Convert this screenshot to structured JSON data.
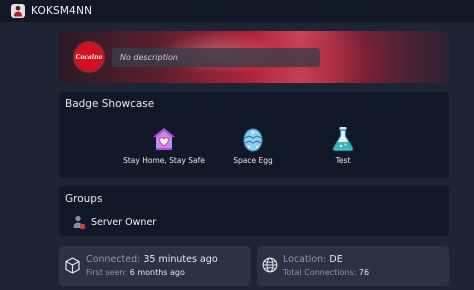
{
  "header": {
    "username": "KOKSM4NN",
    "avatar_icon": "person-avatar-icon"
  },
  "banner": {
    "logo_text": "Cocaine",
    "description": "No description",
    "logo_color": "#d2101f"
  },
  "badge_showcase": {
    "title": "Badge Showcase",
    "badges": [
      {
        "label": "Stay Home, Stay Safe",
        "icon": "heart-house-icon"
      },
      {
        "label": "Space Egg",
        "icon": "egg-icon"
      },
      {
        "label": "Test",
        "icon": "flask-icon"
      }
    ]
  },
  "groups": {
    "title": "Groups",
    "items": [
      {
        "label": "Server Owner",
        "icon": "person-icon"
      }
    ]
  },
  "stats": {
    "connected_label": "Connected:",
    "connected_value": "35 minutes ago",
    "first_seen_label": "First seen:",
    "first_seen_value": "6 months ago",
    "location_label": "Location:",
    "location_value": "DE",
    "total_connections_label": "Total Connections:",
    "total_connections_value": "76"
  },
  "colors": {
    "background": "#1d2433",
    "panel": "#111827",
    "card": "#2b3245",
    "muted_text": "#8e97ad"
  }
}
